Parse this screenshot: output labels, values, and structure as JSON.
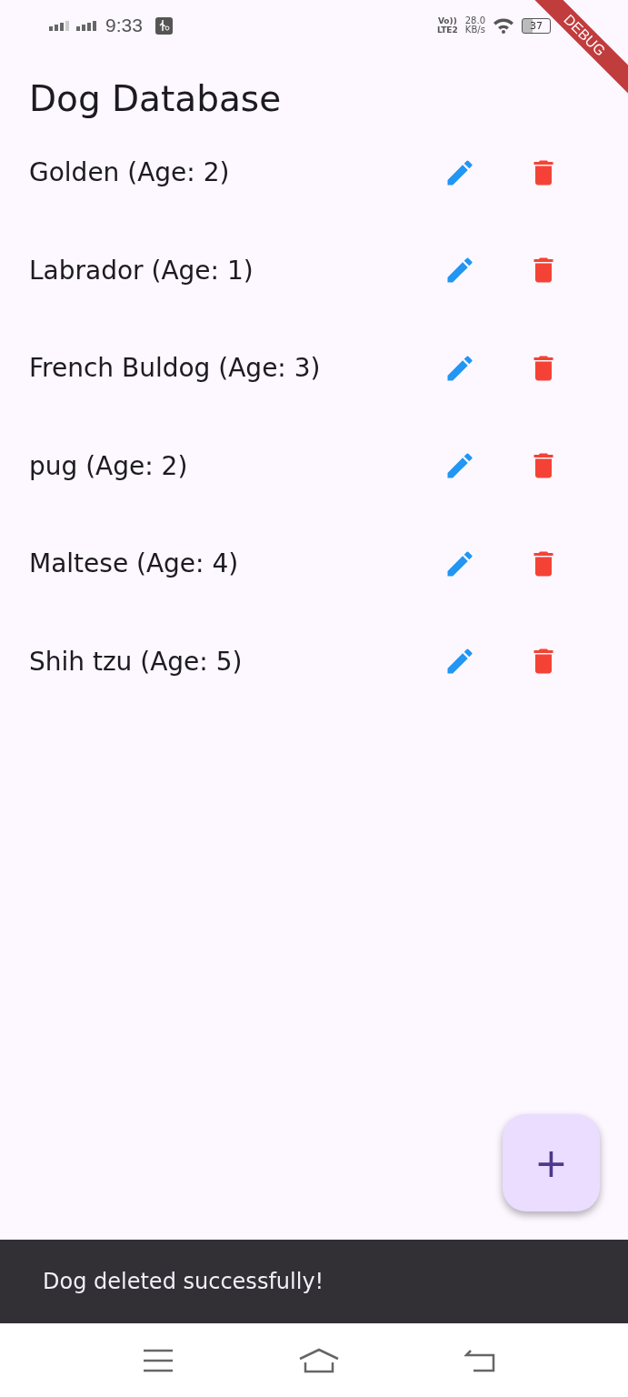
{
  "status_bar": {
    "time": "9:33",
    "volte": "Vo))",
    "lte": "LTE2",
    "speed": "28.0",
    "speed_unit": "KB/s",
    "battery": "37"
  },
  "debug_banner": "DEBUG",
  "title": "Dog Database",
  "dogs": [
    {
      "label": "Golden (Age: 2)"
    },
    {
      "label": "Labrador (Age: 1)"
    },
    {
      "label": "French Buldog (Age: 3)"
    },
    {
      "label": "pug (Age: 2)"
    },
    {
      "label": "Maltese (Age: 4)"
    },
    {
      "label": "Shih tzu (Age: 5)"
    }
  ],
  "fab": "+",
  "snackbar": "Dog deleted successfully!"
}
